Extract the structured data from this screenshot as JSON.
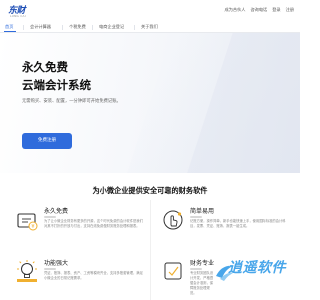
{
  "brand": {
    "logo_text": "东财",
    "logo_sub": "LUNG CAI"
  },
  "top_links": [
    "成为合伙人",
    "咨询电话",
    "登录",
    "注册"
  ],
  "nav": {
    "items": [
      {
        "label": "首页",
        "active": true
      },
      {
        "label": "会计计算器",
        "active": false
      },
      {
        "label": "个税免费",
        "active": false
      },
      {
        "label": "电商企业登记",
        "active": false
      },
      {
        "label": "关于我们",
        "active": false
      }
    ]
  },
  "hero": {
    "title_line1": "永久免费",
    "title_line2": "云端会计系统",
    "subtitle": "无需购买、安装、配置，一分钟即可开始免费记账。",
    "button": "免费注册"
  },
  "section": {
    "title": "为小微企业提供安全可靠的财务软件",
    "features": [
      {
        "title": "永久免费",
        "desc": "为了让小微企业财务有更多的开源，这个时代免费的会计软件是我们对其不打折的开放与付出，支持在线免费做财务账务处理和报表。"
      },
      {
        "title": "简单易用",
        "desc": "记账方便，操作简单，新手也能快速上手，使用国际标准的会计科目，发票、凭证、账簿、报表一键生成。"
      },
      {
        "title": "功能强大",
        "desc": "凭证、账簿、报表、资产、工资等模块齐全，支持多账套管理，满足小微企业的日常记账需求。"
      },
      {
        "title": "财务专业",
        "desc": "专业财务团队设计开发，严格遵循会计准则，保障账务处理规范。"
      }
    ]
  },
  "watermark": {
    "text": "逍遥软件"
  },
  "colors": {
    "accent": "#2f6bdc",
    "brand": "#1f4fb6",
    "watermark": "#2896e6"
  }
}
